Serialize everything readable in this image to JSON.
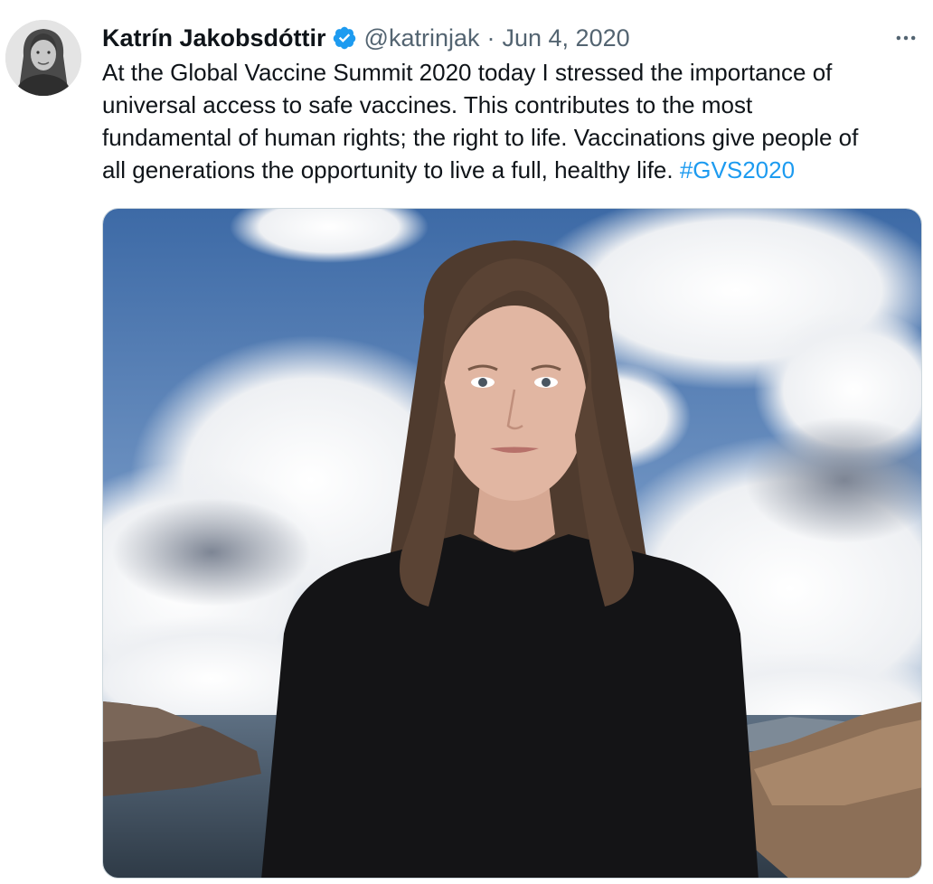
{
  "tweet": {
    "author": {
      "name": "Katrín Jakobsdóttir",
      "handle": "@katrinjak",
      "verified_icon": "verified-badge-icon"
    },
    "separator": "·",
    "date": "Jun 4, 2020",
    "more_icon": "more-options-icon",
    "text_lines": [
      "At the Global Vaccine Summit 2020 today I stressed the importance of",
      "universal access to safe vaccines. This contributes to the most",
      "fundamental of human rights; the right to life. Vaccinations give people of",
      "all generations the opportunity to live a full, healthy life. "
    ],
    "hashtag": "#GVS2020",
    "colors": {
      "text": "#0f1419",
      "secondary": "#536471",
      "accent": "#1d9bf0"
    }
  }
}
